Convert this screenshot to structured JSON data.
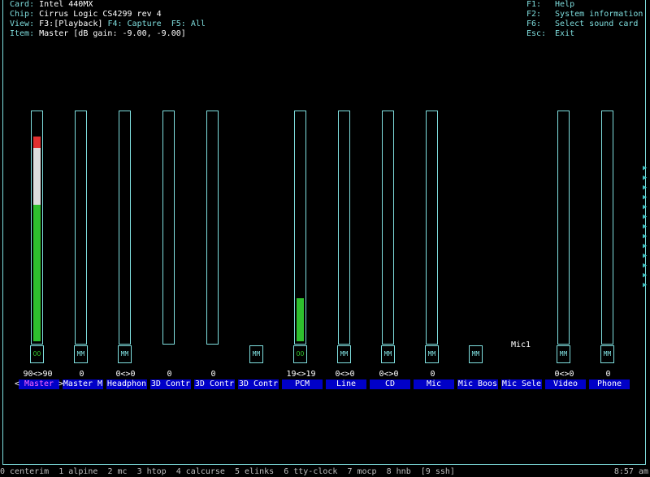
{
  "info": {
    "card_label": "Card:",
    "card": "Intel 440MX",
    "chip_label": "Chip:",
    "chip": "Cirrus Logic CS4299 rev 4",
    "view_label": "View:",
    "view_playback": "F3:[Playback]",
    "view_capture": "F4: Capture",
    "view_all": "F5: All",
    "item_label": "Item:",
    "item": "Master [dB gain: -9.00, -9.00]"
  },
  "keys": [
    {
      "key": "F1:",
      "desc": "Help"
    },
    {
      "key": "F2:",
      "desc": "System information"
    },
    {
      "key": "F6:",
      "desc": "Select sound card"
    },
    {
      "key": "Esc:",
      "desc": "Exit"
    }
  ],
  "channels": [
    {
      "name": "Master",
      "value": "90<>90",
      "switch": "OO",
      "level": 90
    },
    {
      "name": "Master M",
      "value": "0",
      "switch": "MM",
      "level": 0
    },
    {
      "name": "Headphon",
      "value": "0<>0",
      "switch": "MM",
      "level": 0
    },
    {
      "name": "3D Contr",
      "value": "0",
      "switch": "",
      "level": 0
    },
    {
      "name": "3D Contr",
      "value": "0",
      "switch": "",
      "level": 0
    },
    {
      "name": "3D Contr",
      "value": "",
      "switch": "MM",
      "level": null
    },
    {
      "name": "PCM",
      "value": "19<>19",
      "switch": "OO",
      "level": 19
    },
    {
      "name": "Line",
      "value": "0<>0",
      "switch": "MM",
      "level": 0
    },
    {
      "name": "CD",
      "value": "0<>0",
      "switch": "MM",
      "level": 0
    },
    {
      "name": "Mic",
      "value": "0",
      "switch": "MM",
      "level": 0
    },
    {
      "name": "Mic Boos",
      "value": "",
      "switch": "MM",
      "level": null
    },
    {
      "name": "Mic Sele",
      "value": "",
      "switch": "",
      "level": null,
      "enum": "Mic1"
    },
    {
      "name": "Video",
      "value": "0<>0",
      "switch": "MM",
      "level": 0
    },
    {
      "name": "Phone",
      "value": "0",
      "switch": "MM",
      "level": 0
    }
  ],
  "nav_left": "<",
  "nav_right": ">",
  "scroll_marker": "▶",
  "status_bar": {
    "windows": "0 centerim  1 alpine  2 mc  3 htop  4 calcurse  5 elinks  6 tty-clock  7 mocp  8 hnb  [9 ssh]",
    "clock": "8:57 am"
  },
  "colors": {
    "border": "#7fdfdf",
    "level_green": "#2ec02e",
    "level_white": "#dcdcdc",
    "level_red": "#e03030",
    "label_bg": "#0000c8",
    "selected_label": "#ff66ff"
  }
}
